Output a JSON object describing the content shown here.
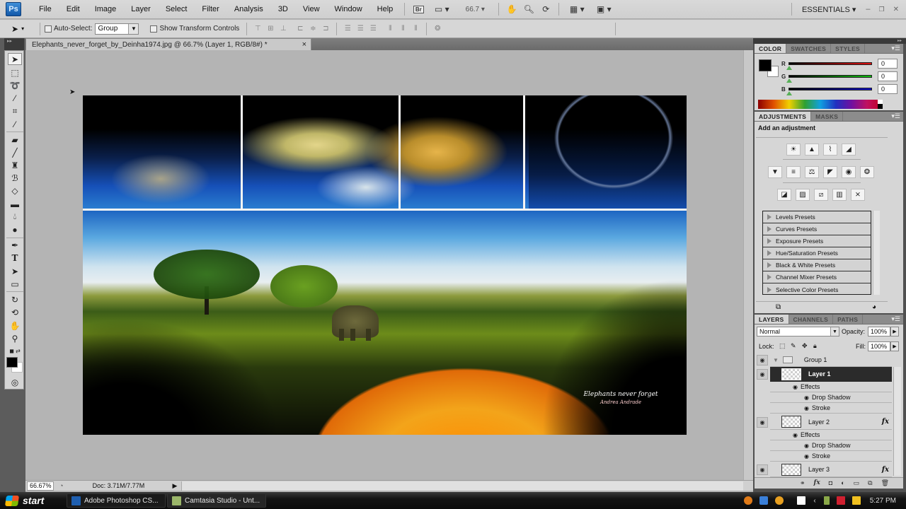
{
  "app": {
    "logo": "Ps",
    "workspace": "ESSENTIALS"
  },
  "menu": [
    "File",
    "Edit",
    "Image",
    "Layer",
    "Select",
    "Filter",
    "Analysis",
    "3D",
    "View",
    "Window",
    "Help"
  ],
  "menubar_icons": {
    "bridge": "Br",
    "zoom_level": "66.7"
  },
  "window_controls": {
    "minimize": "–",
    "restore": "❐",
    "close": "✕"
  },
  "options": {
    "auto_select_label": "Auto-Select:",
    "auto_select_checked": false,
    "auto_select_value": "Group",
    "show_transform_label": "Show Transform Controls",
    "show_transform_checked": false
  },
  "document": {
    "tab_title": "Elephants_never_forget_by_Deinha1974.jpg @ 66.7% (Layer 1, RGB/8#) *",
    "tab_close": "×",
    "signature_title": "Elephants never forget",
    "signature_author": "Andrea Andrade"
  },
  "status": {
    "zoom": "66.67%",
    "doc_size": "Doc: 3.71M/7.77M"
  },
  "color_panel": {
    "tabs": [
      "COLOR",
      "SWATCHES",
      "STYLES"
    ],
    "active_tab": "COLOR",
    "foreground": "#000000",
    "background": "#ffffff",
    "channels": [
      {
        "label": "R",
        "value": "0",
        "color": "#e01010"
      },
      {
        "label": "G",
        "value": "0",
        "color": "#10c010"
      },
      {
        "label": "B",
        "value": "0",
        "color": "#1010d0"
      }
    ]
  },
  "adjustments_panel": {
    "tabs": [
      "ADJUSTMENTS",
      "MASKS"
    ],
    "active_tab": "ADJUSTMENTS",
    "heading": "Add an adjustment",
    "icons_row1": [
      "brightness-contrast",
      "levels",
      "curves",
      "exposure"
    ],
    "icons_row2": [
      "vibrance",
      "hue-saturation",
      "color-balance",
      "black-white",
      "photo-filter",
      "channel-mixer"
    ],
    "icons_row3": [
      "invert",
      "posterize",
      "threshold",
      "gradient-map",
      "selective-color"
    ],
    "presets": [
      "Levels Presets",
      "Curves Presets",
      "Exposure Presets",
      "Hue/Saturation Presets",
      "Black & White Presets",
      "Channel Mixer Presets",
      "Selective Color Presets"
    ]
  },
  "layers_panel": {
    "tabs": [
      "LAYERS",
      "CHANNELS",
      "PATHS"
    ],
    "active_tab": "LAYERS",
    "blend_mode": "Normal",
    "opacity_label": "Opacity:",
    "opacity": "100%",
    "lock_label": "Lock:",
    "fill_label": "Fill:",
    "fill": "100%",
    "rows": [
      {
        "type": "group",
        "name": "Group 1",
        "visible": true
      },
      {
        "type": "layer",
        "name": "Layer 1",
        "visible": true,
        "selected": true
      },
      {
        "type": "effects",
        "name": "Effects"
      },
      {
        "type": "effect",
        "name": "Drop Shadow"
      },
      {
        "type": "effect",
        "name": "Stroke"
      },
      {
        "type": "layer",
        "name": "Layer 2",
        "visible": true,
        "fx": "fx"
      },
      {
        "type": "effects",
        "name": "Effects"
      },
      {
        "type": "effect",
        "name": "Drop Shadow"
      },
      {
        "type": "effect",
        "name": "Stroke"
      },
      {
        "type": "layer",
        "name": "Layer 3",
        "visible": true,
        "fx": "fx"
      }
    ]
  },
  "taskbar": {
    "start": "start",
    "tasks": [
      {
        "label": "Adobe Photoshop CS...",
        "active": true
      },
      {
        "label": "Camtasia Studio - Unt...",
        "active": false
      }
    ],
    "clock": "5:27 PM"
  }
}
